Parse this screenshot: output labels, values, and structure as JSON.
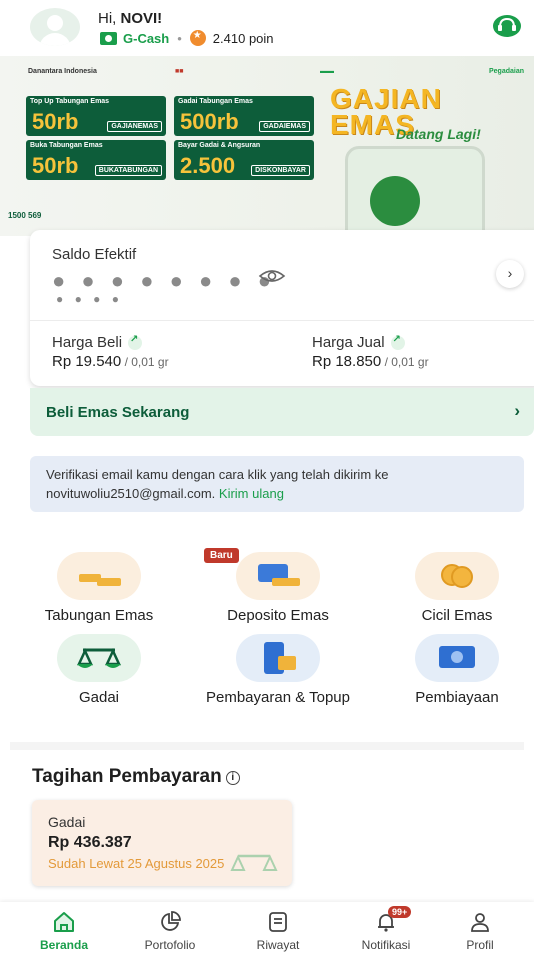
{
  "header": {
    "greeting_prefix": "Hi, ",
    "user_name": "NOVI!",
    "gcash_label": "G-Cash",
    "poin_text": "2.410 poin"
  },
  "banner": {
    "logo_1": "Danantara Indonesia",
    "logo_4": "Pegadaian",
    "card_1_title": "Top Up Tabungan Emas",
    "card_1_value": "50rb",
    "card_1_code": "GAJIANEMAS",
    "card_2_title": "Gadai Tabungan Emas",
    "card_2_value": "500rb",
    "card_2_code": "GADAIEMAS",
    "card_3_title": "Buka Tabungan Emas",
    "card_3_value": "50rb",
    "card_3_code": "BUKATABUNGAN",
    "card_4_title": "Bayar Gadai & Angsuran",
    "card_4_value": "2.500",
    "card_4_code": "DISKONBAYAR",
    "hero_line_1": "GAJIAN",
    "hero_line_2": "EMAS",
    "hero_sub": "Datang Lagi!",
    "phone": "1500 569"
  },
  "saldo": {
    "title": "Saldo Efektif",
    "masked_main": "● ● ● ● ● ● ● ●",
    "masked_sub": "● ● ● ●",
    "beli_label": "Harga Beli",
    "beli_value": "Rp 19.540",
    "beli_unit": " / 0,01 gr",
    "jual_label": "Harga Jual",
    "jual_value": "Rp 18.850",
    "jual_unit": " / 0,01 gr"
  },
  "beli_strip": {
    "label": "Beli Emas Sekarang"
  },
  "verify": {
    "text": "Verifikasi email kamu dengan cara klik yang telah dikirim ke novituwoliu2510@gmail.com. ",
    "link": "Kirim ulang"
  },
  "menu": {
    "badge": "Baru",
    "items": [
      {
        "label": "Tabungan Emas"
      },
      {
        "label": "Deposito Emas"
      },
      {
        "label": "Cicil Emas"
      },
      {
        "label": "Gadai"
      },
      {
        "label": "Pembayaran & Topup"
      },
      {
        "label": "Pembiayaan"
      }
    ]
  },
  "tagihan": {
    "title": "Tagihan Pembayaran",
    "card_type": "Gadai",
    "amount": "Rp 436.387",
    "status": "Sudah Lewat 25 Agustus 2025"
  },
  "nav": {
    "items": [
      {
        "label": "Beranda"
      },
      {
        "label": "Portofolio"
      },
      {
        "label": "Riwayat"
      },
      {
        "label": "Notifikasi"
      },
      {
        "label": "Profil"
      }
    ],
    "notif_badge": "99+"
  },
  "colors": {
    "brand_green": "#1a9e4b",
    "dark_green": "#0d5d3a",
    "accent_orange": "#f08c2e"
  }
}
